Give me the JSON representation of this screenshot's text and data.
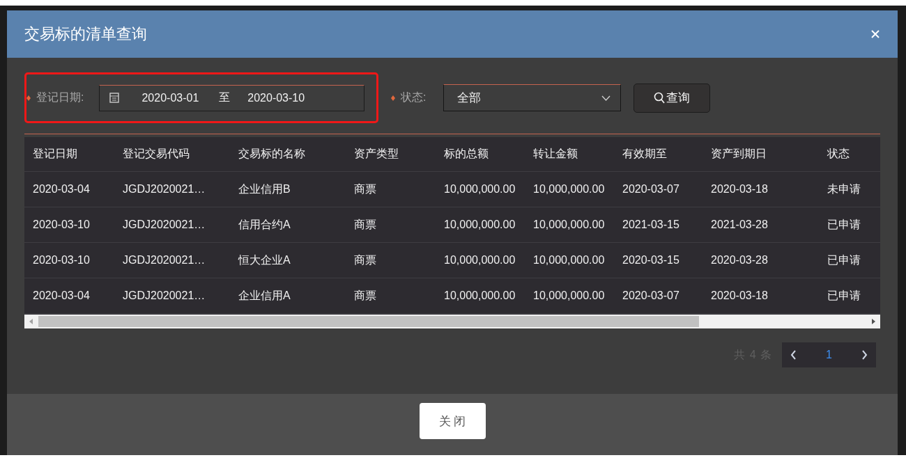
{
  "dialog": {
    "title": "交易标的清单查询"
  },
  "filters": {
    "date_label": "登记日期:",
    "date_start": "2020-03-01",
    "date_separator": "至",
    "date_end": "2020-03-10",
    "status_label": "状态:",
    "status_value": "全部",
    "search_button": "查询"
  },
  "table": {
    "columns": [
      "登记日期",
      "登记交易代码",
      "交易标的名称",
      "资产类型",
      "标的总额",
      "转让金额",
      "有效期至",
      "资产到期日",
      "状态"
    ],
    "rows": [
      [
        "2020-03-04",
        "JGDJ2020021…",
        "企业信用B",
        "商票",
        "10,000,000.00",
        "10,000,000.00",
        "2020-03-07",
        "2020-03-18",
        "未申请"
      ],
      [
        "2020-03-10",
        "JGDJ2020021…",
        "信用合约A",
        "商票",
        "10,000,000.00",
        "10,000,000.00",
        "2021-03-15",
        "2021-03-28",
        "已申请"
      ],
      [
        "2020-03-10",
        "JGDJ2020021…",
        "恒大企业A",
        "商票",
        "10,000,000.00",
        "10,000,000.00",
        "2020-03-15",
        "2020-03-28",
        "已申请"
      ],
      [
        "2020-03-04",
        "JGDJ2020021…",
        "企业信用A",
        "商票",
        "10,000,000.00",
        "10,000,000.00",
        "2020-03-07",
        "2020-03-18",
        "已申请"
      ]
    ]
  },
  "pagination": {
    "total": "共 4 条",
    "pages": [
      {
        "label": "1",
        "selected": true
      }
    ]
  },
  "footer": {
    "close_button": "关闭"
  }
}
